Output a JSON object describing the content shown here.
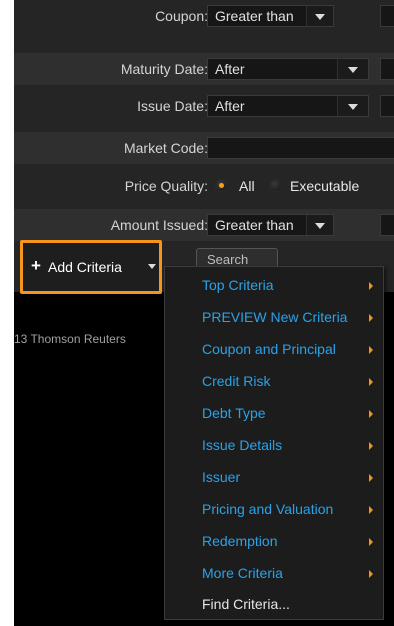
{
  "form": {
    "coupon": {
      "label": "Coupon:",
      "value": "Greater than"
    },
    "maturity": {
      "label": "Maturity Date:",
      "value": "After"
    },
    "issue_date": {
      "label": "Issue Date:",
      "value": "After"
    },
    "market_code": {
      "label": "Market Code:",
      "value": ""
    },
    "price_quality": {
      "label": "Price Quality:",
      "options": [
        "All",
        "Executable"
      ],
      "selected": "All"
    },
    "amount_issued": {
      "label": "Amount Issued:",
      "value": "Greater than"
    }
  },
  "actions": {
    "add_criteria": "Add Criteria",
    "search": "Search"
  },
  "footer": {
    "copyright_fragment": "13 Thomson Reuters"
  },
  "menu": {
    "items": [
      {
        "label": "Top Criteria",
        "has_submenu": true
      },
      {
        "label": "PREVIEW New Criteria",
        "has_submenu": true
      },
      {
        "label": "Coupon and Principal",
        "has_submenu": true
      },
      {
        "label": "Credit Risk",
        "has_submenu": true
      },
      {
        "label": "Debt Type",
        "has_submenu": true
      },
      {
        "label": "Issue Details",
        "has_submenu": true
      },
      {
        "label": "Issuer",
        "has_submenu": true
      },
      {
        "label": "Pricing and Valuation",
        "has_submenu": true
      },
      {
        "label": "Redemption",
        "has_submenu": true
      },
      {
        "label": "More Criteria",
        "has_submenu": true
      },
      {
        "label": "Find Criteria...",
        "has_submenu": false
      }
    ]
  },
  "colors": {
    "accent": "#f7941d",
    "menu_link": "#2aa2e8",
    "background": "#252525"
  }
}
